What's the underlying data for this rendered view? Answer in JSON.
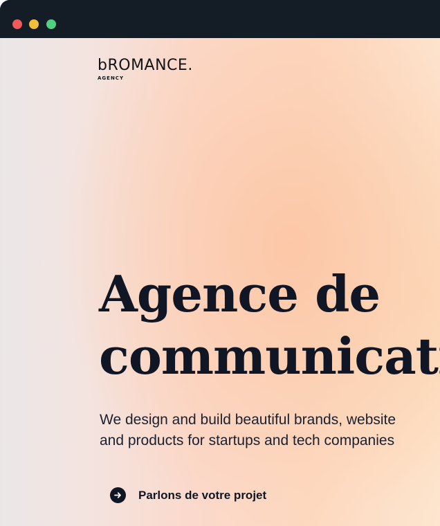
{
  "window": {
    "controls": [
      "close",
      "minimize",
      "maximize"
    ]
  },
  "brand": {
    "name": "bROMANCE.",
    "tagline": "AGENCY"
  },
  "hero": {
    "headline_line1": "Agence de",
    "headline_line2": "communicati",
    "lede_line1": "We design and build beautiful brands, website",
    "lede_line2": "and products for startups and tech companies",
    "cta_label": "Parlons de votre projet",
    "cta_icon": "arrow-right-icon"
  },
  "colors": {
    "titlebar": "#141c26",
    "close": "#ef5a5a",
    "minimize": "#f4be3a",
    "maximize": "#4fd17f",
    "text": "#101624"
  }
}
